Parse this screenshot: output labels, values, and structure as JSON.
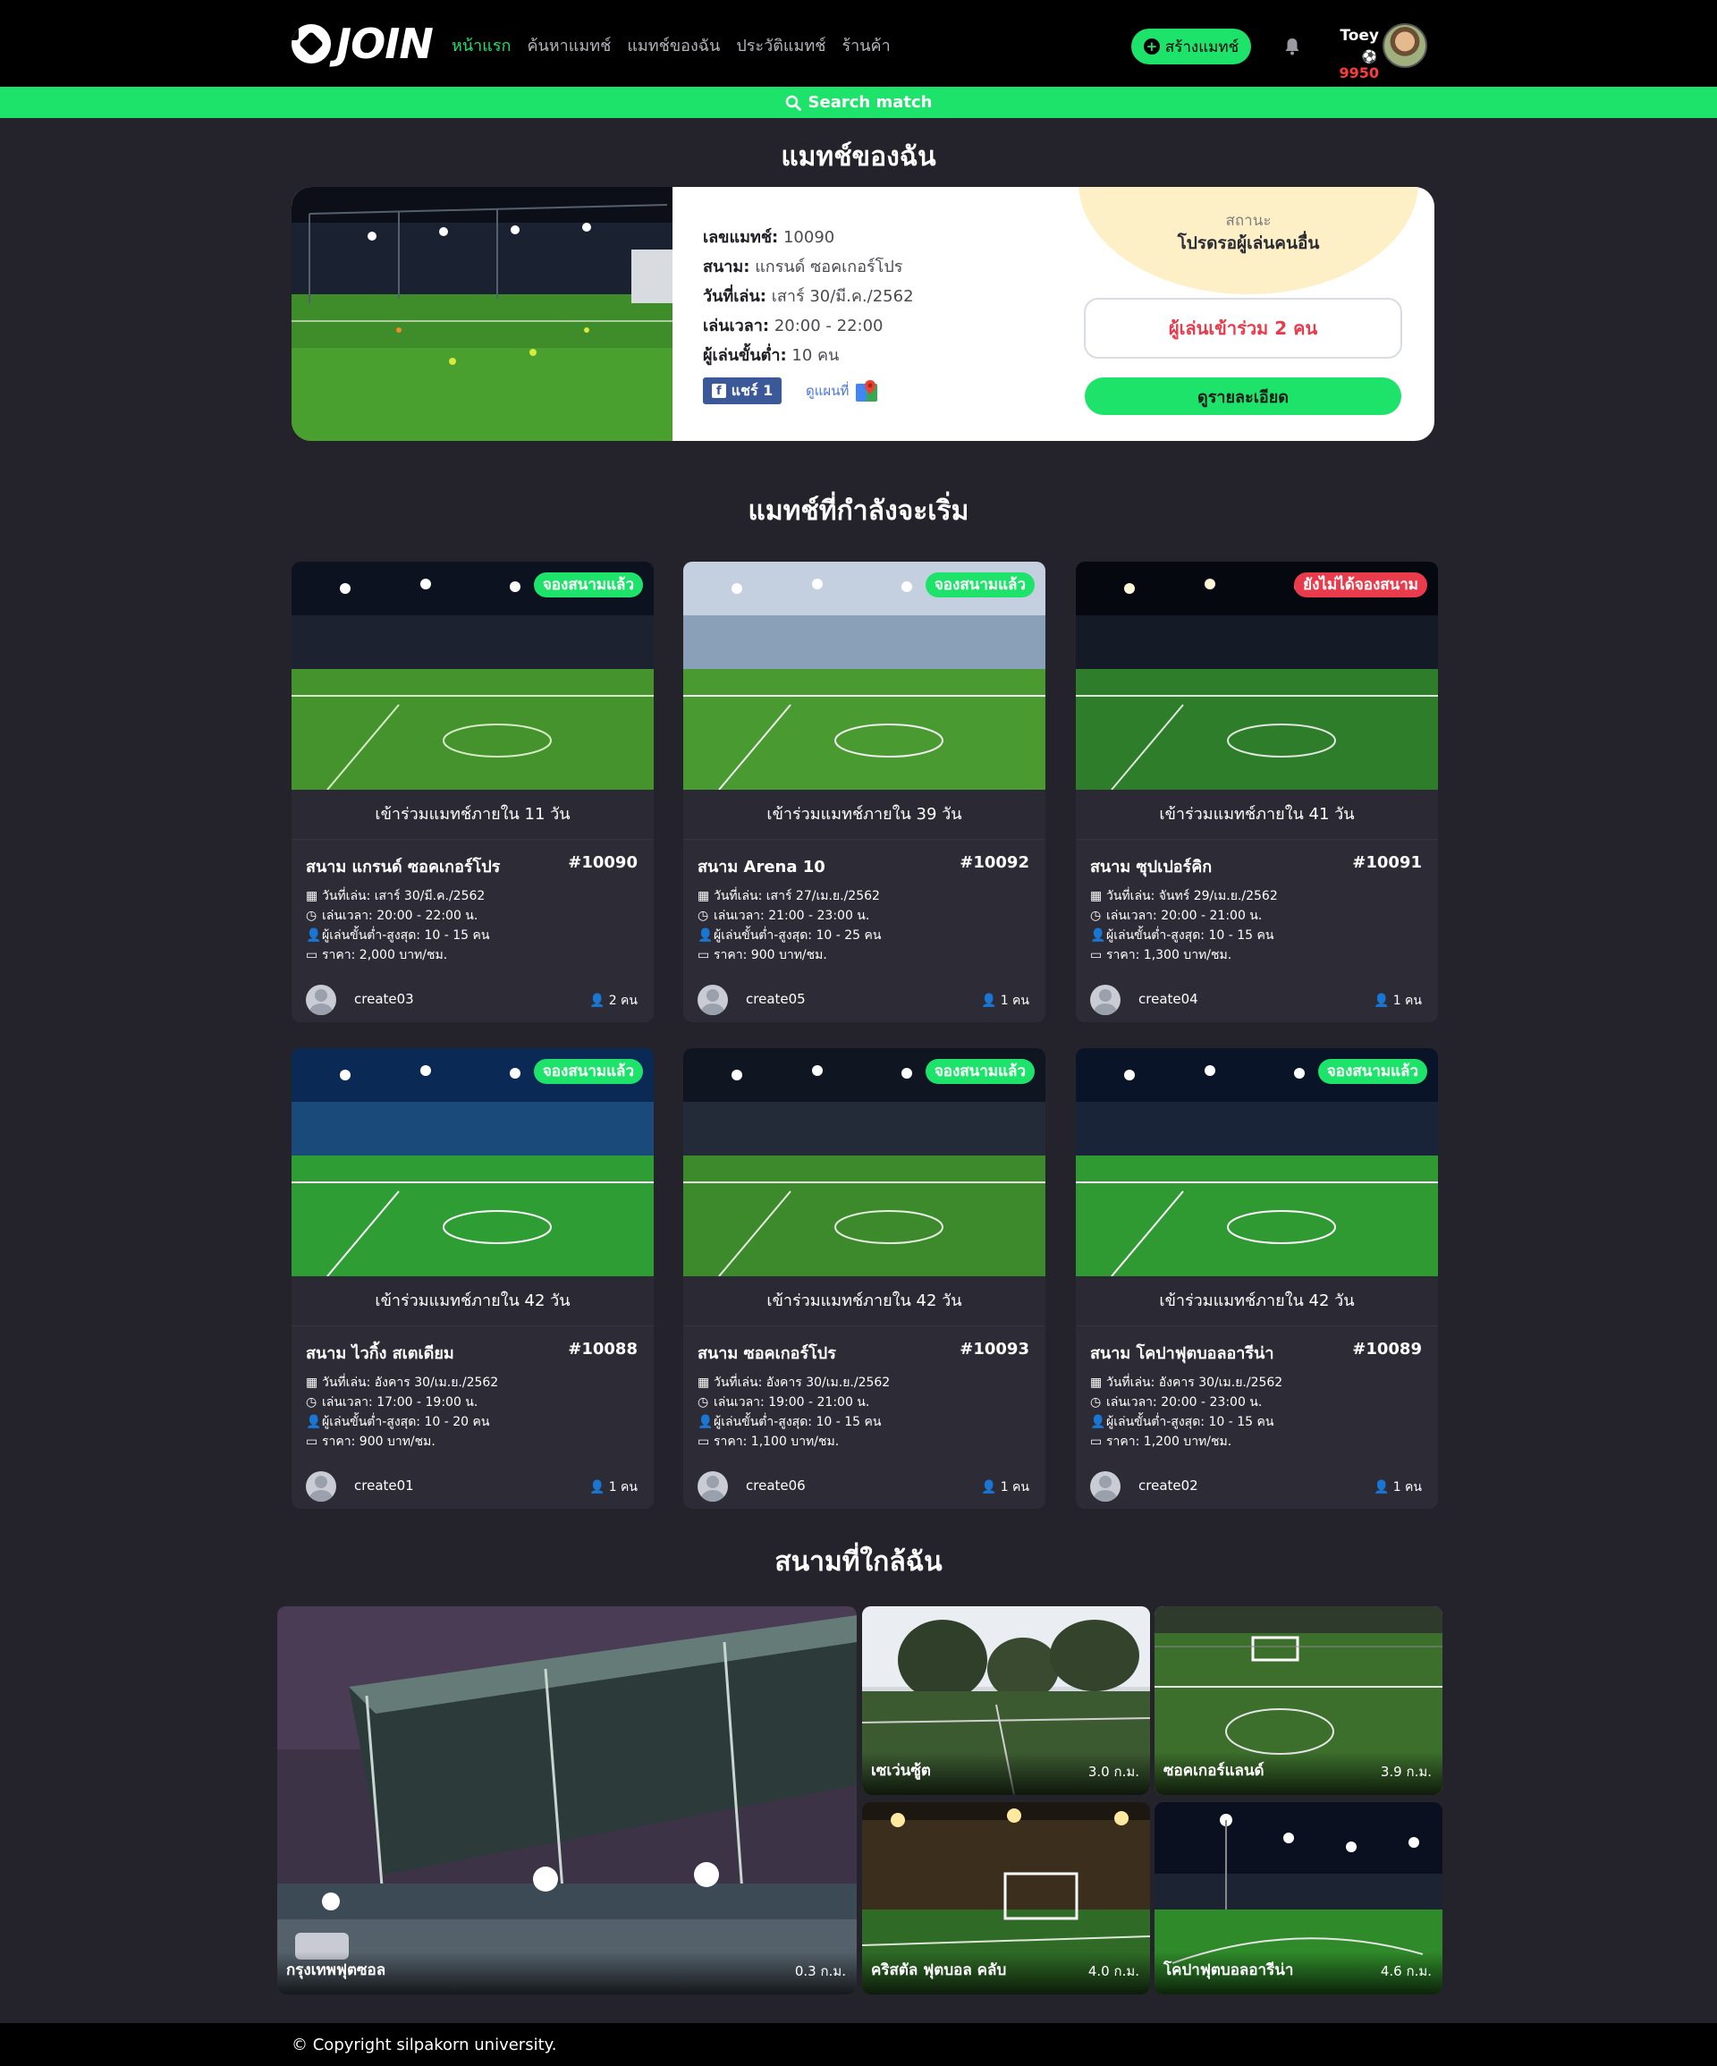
{
  "header": {
    "logo_text": "JOIN",
    "nav": [
      {
        "label": "หน้าแรก",
        "active": true
      },
      {
        "label": "ค้นหาแมทช์",
        "active": false
      },
      {
        "label": "แมทช์ของฉัน",
        "active": false
      },
      {
        "label": "ประวัติแมทช์",
        "active": false
      },
      {
        "label": "ร้านค้า",
        "active": false
      }
    ],
    "create_button": "สร้างแมทช์",
    "user_name": "Toey",
    "user_points": "9950",
    "search_label": "Search match",
    "accent_color": "#1ee36a"
  },
  "my_match": {
    "section_title": "แมทช์ของฉัน",
    "match_no_label": "เลขแมทช์:",
    "match_no": "10090",
    "field_label": "สนาม:",
    "field": "แกรนด์ ซอคเกอร์โปร",
    "date_label": "วันที่เล่น:",
    "date": "เสาร์ 30/มี.ค./2562",
    "time_label": "เล่นเวลา:",
    "time": "20:00 - 22:00",
    "min_players_label": "ผู้เล่นขั้นต่ำ:",
    "min_players": "10 คน",
    "share_label": "แชร์ 1",
    "map_label": "ดูแผนที่",
    "status_label": "สถานะ",
    "status_text": "โปรดรอผู้เล่นคนอื่น",
    "joined_text": "ผู้เล่นเข้าร่วม 2 คน",
    "detail_button": "ดูรายละเอียด"
  },
  "upcoming": {
    "section_title": "แมทช์ที่กำลังจะเริ่ม",
    "date_prefix": "วันที่เล่น:",
    "time_prefix": "เล่นเวลา:",
    "players_prefix": "ผู้เล่นขั้นต่ำ-สูงสุด:",
    "price_prefix": "ราคา:",
    "matches": [
      {
        "badge": "จองสนามแล้ว",
        "booked": true,
        "countdown": "เข้าร่วมแมทช์ภายใน 11 วัน",
        "field": "สนาม แกรนด์ ซอคเกอร์โปร",
        "id": "#10090",
        "date": "เสาร์ 30/มี.ค./2562",
        "time": "20:00 - 22:00 น.",
        "players": "10 - 15 คน",
        "price": "2,000 บาท/ชม.",
        "creator": "create03",
        "joined": "2 คน"
      },
      {
        "badge": "จองสนามแล้ว",
        "booked": true,
        "countdown": "เข้าร่วมแมทช์ภายใน 39 วัน",
        "field": "สนาม Arena 10",
        "id": "#10092",
        "date": "เสาร์ 27/เม.ย./2562",
        "time": "21:00 - 23:00 น.",
        "players": "10 - 25 คน",
        "price": "900 บาท/ชม.",
        "creator": "create05",
        "joined": "1 คน"
      },
      {
        "badge": "ยังไม่ได้จองสนาม",
        "booked": false,
        "countdown": "เข้าร่วมแมทช์ภายใน 41 วัน",
        "field": "สนาม ซุปเปอร์คิก",
        "id": "#10091",
        "date": "จันทร์ 29/เม.ย./2562",
        "time": "20:00 - 21:00 น.",
        "players": "10 - 15 คน",
        "price": "1,300 บาท/ชม.",
        "creator": "create04",
        "joined": "1 คน"
      },
      {
        "badge": "จองสนามแล้ว",
        "booked": true,
        "countdown": "เข้าร่วมแมทช์ภายใน 42 วัน",
        "field": "สนาม ไวกิ้ง สเตเดียม",
        "id": "#10088",
        "date": "อังคาร 30/เม.ย./2562",
        "time": "17:00 - 19:00 น.",
        "players": "10 - 20 คน",
        "price": "900 บาท/ชม.",
        "creator": "create01",
        "joined": "1 คน"
      },
      {
        "badge": "จองสนามแล้ว",
        "booked": true,
        "countdown": "เข้าร่วมแมทช์ภายใน 42 วัน",
        "field": "สนาม ซอคเกอร์โปร",
        "id": "#10093",
        "date": "อังคาร 30/เม.ย./2562",
        "time": "19:00 - 21:00 น.",
        "players": "10 - 15 คน",
        "price": "1,100 บาท/ชม.",
        "creator": "create06",
        "joined": "1 คน"
      },
      {
        "badge": "จองสนามแล้ว",
        "booked": true,
        "countdown": "เข้าร่วมแมทช์ภายใน 42 วัน",
        "field": "สนาม โคปาฟุตบอลอารีน่า",
        "id": "#10089",
        "date": "อังคาร 30/เม.ย./2562",
        "time": "20:00 - 23:00 น.",
        "players": "10 - 15 คน",
        "price": "1,200 บาท/ชม.",
        "creator": "create02",
        "joined": "1 คน"
      }
    ]
  },
  "nearby": {
    "section_title": "สนามที่ใกล้ฉัน",
    "fields": [
      {
        "name": "กรุงเทพฟุตซอล",
        "distance": "0.3 ก.ม."
      },
      {
        "name": "เซเว่นซู้ต",
        "distance": "3.0 ก.ม."
      },
      {
        "name": "ซอคเกอร์แลนด์",
        "distance": "3.9 ก.ม."
      },
      {
        "name": "คริสตัล ฟุตบอล คลับ",
        "distance": "4.0 ก.ม."
      },
      {
        "name": "โคปาฟุตบอลอารีน่า",
        "distance": "4.6 ก.ม."
      }
    ]
  },
  "footer": {
    "copyright": "Copyright silpakorn university."
  }
}
